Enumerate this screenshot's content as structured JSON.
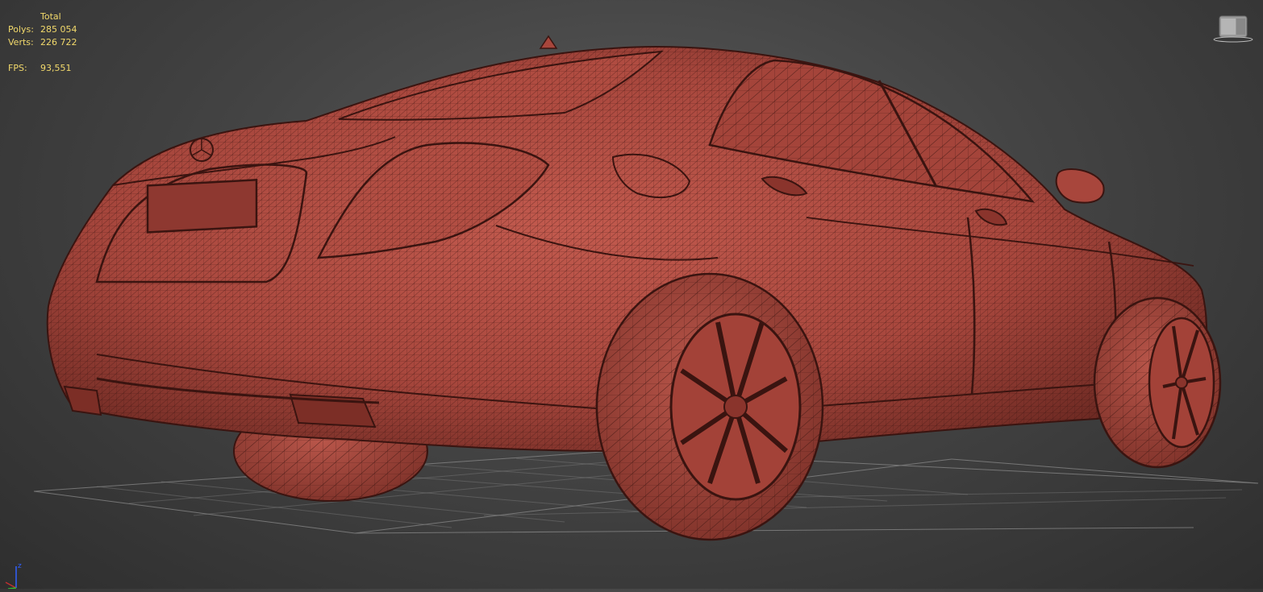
{
  "viewport": {
    "stats": {
      "header": "Total",
      "polys_label": "Polys:",
      "polys_value": "285 054",
      "verts_label": "Verts:",
      "verts_value": "226 722",
      "fps_label": "FPS:",
      "fps_value": "93,551"
    },
    "axis_label": "z",
    "colors": {
      "background": "#444444",
      "stats_text": "#f2d96b",
      "mesh_fill": "#a9493f",
      "wire": "#3a1410",
      "grid": "#8a8a8a",
      "axis_z": "#3060ff",
      "axis_x": "#c03030",
      "axis_y": "#30c030"
    },
    "icons": [
      "viewcube-icon",
      "axis-tripod-icon"
    ]
  }
}
